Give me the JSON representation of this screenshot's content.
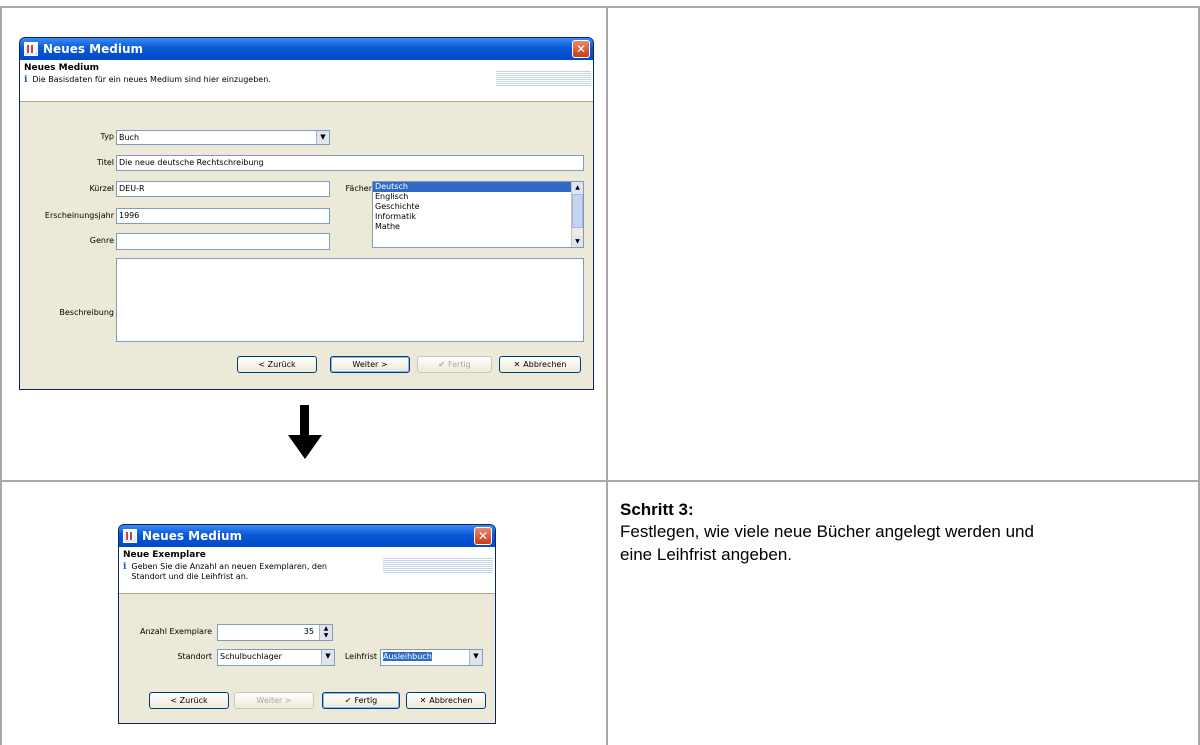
{
  "window1": {
    "title": "Neues Medium",
    "header_title": "Neues Medium",
    "header_desc": "Die Basisdaten für ein neues Medium sind hier einzugeben.",
    "labels": {
      "typ": "Typ",
      "titel": "Titel",
      "kuerzel": "Kürzel",
      "erscheinungsjahr": "Erscheinungsjahr",
      "genre": "Genre",
      "faecher": "Fächer",
      "beschreibung": "Beschreibung"
    },
    "values": {
      "typ": "Buch",
      "titel": "Die neue deutsche Rechtschreibung",
      "kuerzel": "DEU-R",
      "erscheinungsjahr": "1996",
      "genre": "",
      "beschreibung": ""
    },
    "faecher_items": [
      "Deutsch",
      "Englisch",
      "Geschichte",
      "Informatik",
      "Mathe"
    ],
    "buttons": {
      "back": "< Zurück",
      "next": "Weiter >",
      "finish": "Fertig",
      "cancel": "Abbrechen"
    }
  },
  "window2": {
    "title": "Neues Medium",
    "header_title": "Neue Exemplare",
    "header_desc_line1": "Geben Sie die Anzahl an neuen Exemplaren, den",
    "header_desc_line2": "Standort und die Leihfrist an.",
    "labels": {
      "anzahl": "Anzahl Exemplare",
      "standort": "Standort",
      "leihfrist": "Leihfrist"
    },
    "values": {
      "anzahl": "35",
      "standort": "Schulbuchlager",
      "leihfrist": "Ausleihbuch"
    },
    "buttons": {
      "back": "< Zurück",
      "next": "Weiter >",
      "finish": "Fertig",
      "cancel": "Abbrechen"
    }
  },
  "step": {
    "title": "Schritt 3:",
    "text": "Festlegen, wie viele neue Bücher angelegt werden und eine Leihfrist angeben."
  },
  "icons": {
    "arrow": "arrow-down-icon",
    "info": "info-icon",
    "close": "close-icon",
    "checkmark": "checkmark-icon"
  },
  "colors": {
    "titlebar": "#0a58d6",
    "window_bg": "#ece9d8",
    "selection": "#316ac5",
    "table_border": "#a8a8a8"
  }
}
